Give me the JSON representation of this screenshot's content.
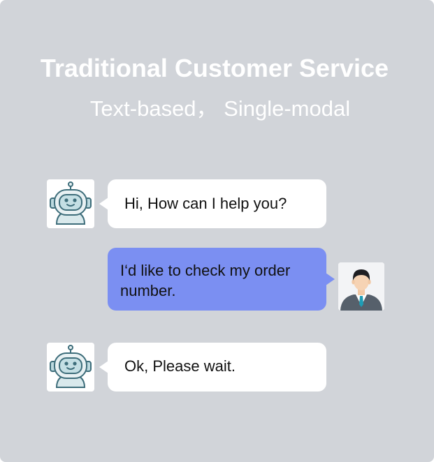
{
  "header": {
    "title": "Traditional Customer Service",
    "subtitle": "Text-based， Single-modal"
  },
  "conversation": {
    "messages": [
      {
        "sender": "bot",
        "avatar_icon": "robot-icon",
        "text": "Hi, How can I help you?"
      },
      {
        "sender": "user",
        "avatar_icon": "businessman-icon",
        "text": "I‘d like to check my order number."
      },
      {
        "sender": "bot",
        "avatar_icon": "robot-icon",
        "text": "Ok, Please wait."
      }
    ]
  },
  "colors": {
    "background": "#d1d4d9",
    "bot_bubble": "#ffffff",
    "user_bubble": "#7b8ff2",
    "title_text": "#ffffff"
  }
}
